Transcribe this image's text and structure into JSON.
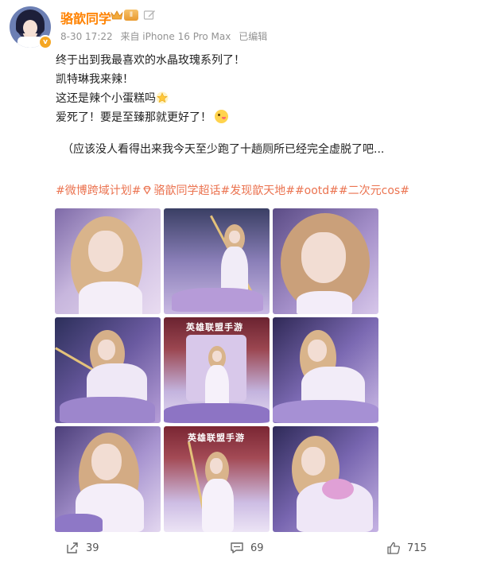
{
  "user": {
    "name": "骆歆同学",
    "level_badge": "Ⅱ",
    "verified_badge": "v"
  },
  "meta": {
    "date": "8-30 17:22",
    "source": "来自 iPhone 16 Pro Max",
    "edited": "已编辑"
  },
  "post": {
    "lines": [
      "终于出到我最喜欢的水晶玫瑰系列了！",
      "凯特琳我来辣！",
      "这还是辣个小蛋糕吗",
      "爱死了！要是至臻那就更好了！",
      "（应该没人看得出来我今天至少跑了十趟厕所已经完全虚脱了吧..."
    ],
    "tags": [
      "#微博跨域计划#",
      "骆歆同学超话",
      "#发现歆天地#",
      "#ootd#",
      "#二次元cos#"
    ]
  },
  "images": {
    "signs": [
      "英雄联盟手游",
      "英雄联盟手游"
    ],
    "count": 9
  },
  "actions": {
    "share_count": "39",
    "comment_count": "69",
    "like_count": "715"
  },
  "colors": {
    "username": "#ff8200",
    "tag": "#eb7350",
    "meta": "#939393"
  },
  "icons": [
    "crown-icon",
    "level-badge-icon",
    "edit-icon",
    "star-emoji-icon",
    "tongue-emoji-icon",
    "supertopic-diamond-icon",
    "share-icon",
    "comment-icon",
    "like-icon"
  ]
}
